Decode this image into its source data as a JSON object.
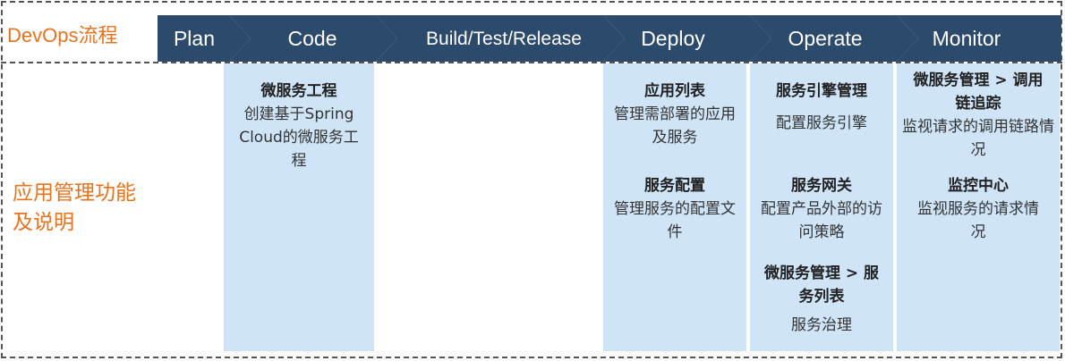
{
  "row1_label": "DevOps流程",
  "row2_label": "应用管理功能及说明",
  "stages": [
    "Plan",
    "Code",
    "Build/Test/Release",
    "Deploy",
    "Operate",
    "Monitor"
  ],
  "columns": {
    "code": [
      {
        "title": "微服务工程",
        "desc": "创建基于Spring Cloud的微服务工程"
      }
    ],
    "deploy": [
      {
        "title": "应用列表",
        "desc": "管理需部署的应用及服务"
      },
      {
        "title": "服务配置",
        "desc": "管理服务的配置文件"
      }
    ],
    "operate": [
      {
        "title": "服务引擎管理",
        "desc": "配置服务引擎"
      },
      {
        "title": "服务网关",
        "desc": "配置产品外部的访问策略"
      },
      {
        "title": "微服务管理 > 服务列表",
        "desc": "服务治理"
      }
    ],
    "monitor": [
      {
        "title": "微服务管理 > 调用链追踪",
        "desc": "监视请求的调用链路情况"
      },
      {
        "title": "监控中心",
        "desc": "监视服务的请求情况"
      }
    ]
  },
  "colors": {
    "stage_bg": "#2C4A6B",
    "accent": "#E8731F",
    "column_bg": "#CFE4F7"
  }
}
